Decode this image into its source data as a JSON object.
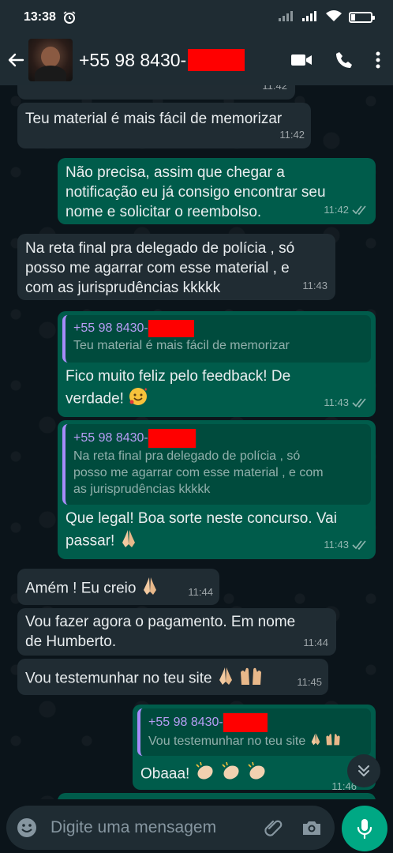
{
  "status_bar": {
    "time": "13:38",
    "battery": "7"
  },
  "header": {
    "contact": "+55 98 8430-"
  },
  "messages": [
    {
      "time": "11:42"
    },
    {
      "text": "Teu material é mais fácil de memorizar",
      "time": "11:42"
    },
    {
      "lines": [
        "Não precisa, assim que chegar a",
        "notificação eu já consigo encontrar seu",
        "nome e solicitar o reembolso."
      ],
      "time": "11:42"
    },
    {
      "lines": [
        "Na reta final pra delegado de polícia , só",
        "posso me agarrar com esse material , e",
        "com as jurisprudências kkkkk"
      ],
      "time": "11:43"
    },
    {
      "quote_name": "+55 98 8430-",
      "quote_text": "Teu material é mais fácil de memorizar",
      "lines": [
        "Fico muito feliz pelo feedback! De",
        "verdade!"
      ],
      "time": "11:43"
    },
    {
      "quote_name": "+55 98 8430-",
      "quote_lines": [
        "Na reta final pra delegado de polícia , só",
        "posso me agarrar com esse material , e com",
        "as jurisprudências kkkkk"
      ],
      "lines": [
        "Que legal! Boa sorte neste concurso. Vai",
        "passar!"
      ],
      "time": "11:43"
    },
    {
      "text": "Amém ! Eu creio",
      "time": "11:44"
    },
    {
      "lines": [
        "Vou fazer agora o pagamento. Em nome",
        "de Humberto."
      ],
      "time": "11:44"
    },
    {
      "text": "Vou testemunhar no teu site",
      "time": "11:45"
    },
    {
      "quote_name": "+55 98 8430-",
      "quote_text": "Vou testemunhar no teu site",
      "text": "Obaaa!",
      "time": "11:46"
    }
  ],
  "input": {
    "placeholder": "Digite uma mensagem"
  },
  "icons": {
    "alarm": "alarm-clock-icon",
    "signal": "signal-icon",
    "wifi": "wifi-icon",
    "battery": "battery-icon",
    "back": "back-arrow-icon",
    "video": "video-call-icon",
    "call": "phone-call-icon",
    "menu": "more-vert-icon",
    "emoji": "emoji-icon",
    "attach": "paperclip-icon",
    "camera": "camera-icon",
    "mic": "mic-icon",
    "scroll": "chevron-double-down-icon",
    "read": "double-check-icon",
    "praying": "praying-hands-emoji",
    "raised": "raised-hands-emoji",
    "clap": "clapping-hands-emoji",
    "smile": "smiling-hearts-emoji"
  },
  "colors": {
    "incoming": "#202c33",
    "outgoing": "#005c4b",
    "accent": "#00a884",
    "quote_bar": "#a78bfa",
    "redaction": "#ff0000"
  }
}
